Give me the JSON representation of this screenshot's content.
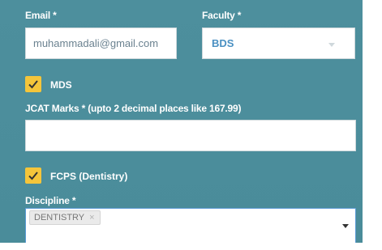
{
  "email": {
    "label": "Email *",
    "value": "muhammadali@gmail.com"
  },
  "faculty": {
    "label": "Faculty *",
    "selected": "BDS"
  },
  "mds": {
    "label": "MDS",
    "checked": true
  },
  "jcat": {
    "label": "JCAT Marks * (upto 2 decimal places like 167.99)",
    "value": ""
  },
  "fcps": {
    "label": "FCPS (Dentistry)",
    "checked": true
  },
  "discipline": {
    "label": "Discipline *",
    "tags": [
      {
        "text": "DENTISTRY",
        "remove": "×"
      }
    ]
  },
  "colors": {
    "panel": "#4d8f9d",
    "checkbox": "#f5c53a",
    "select_text": "#4a90c2"
  }
}
